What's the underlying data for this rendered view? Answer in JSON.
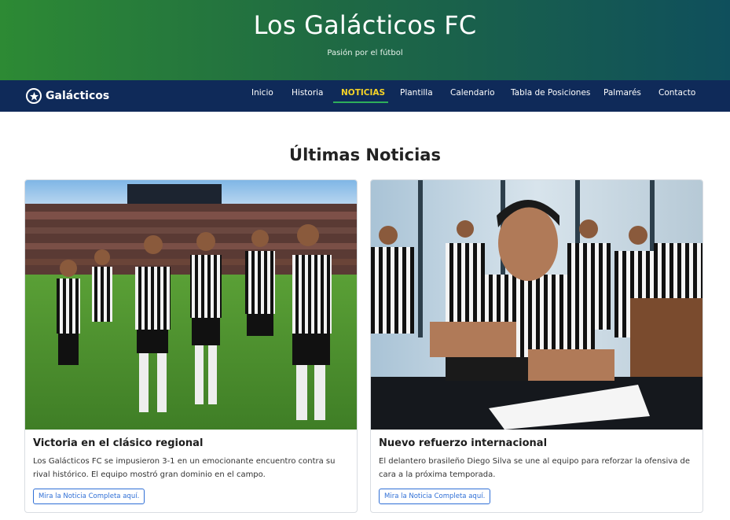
{
  "hero": {
    "title": "Los Galácticos FC",
    "subtitle": "Pasión por el fútbol"
  },
  "nav": {
    "brand": "Galácticos",
    "brand_icon": "soccer-ball-star-icon",
    "items": [
      {
        "label": "Inicio"
      },
      {
        "label": "Historia"
      },
      {
        "label": "NOTICIAS",
        "active": true
      },
      {
        "label": "Plantilla"
      },
      {
        "label": "Calendario"
      },
      {
        "label": "Tabla de Posiciones"
      },
      {
        "label": "Palmarés"
      },
      {
        "label": "Contacto"
      }
    ]
  },
  "main": {
    "section_title": "Últimas Noticias",
    "cards": [
      {
        "title": "Victoria en el clásico regional",
        "text": "Los Galácticos FC se impusieron 3-1 en un emocionante encuentro contra su rival histórico. El equipo mostró gran dominio en el campo.",
        "button": "Mira la Noticia Completa aquí.",
        "image_subject": "players-celebrating-photo"
      },
      {
        "title": "Nuevo refuerzo internacional",
        "text": "El delantero brasileño Diego Silva se une al equipo para reforzar la ofensiva de cara a la próxima temporada.",
        "button": "Mira la Noticia Completa aquí.",
        "image_subject": "player-signing-contract-photo"
      }
    ]
  },
  "colors": {
    "hero_gradient_start": "#2d8a34",
    "hero_gradient_end": "#0f4f5c",
    "nav_bg": "#0f2a59",
    "nav_active": "#f5d327",
    "nav_underline": "#2eae5a",
    "button_accent": "#2f6fd6"
  }
}
